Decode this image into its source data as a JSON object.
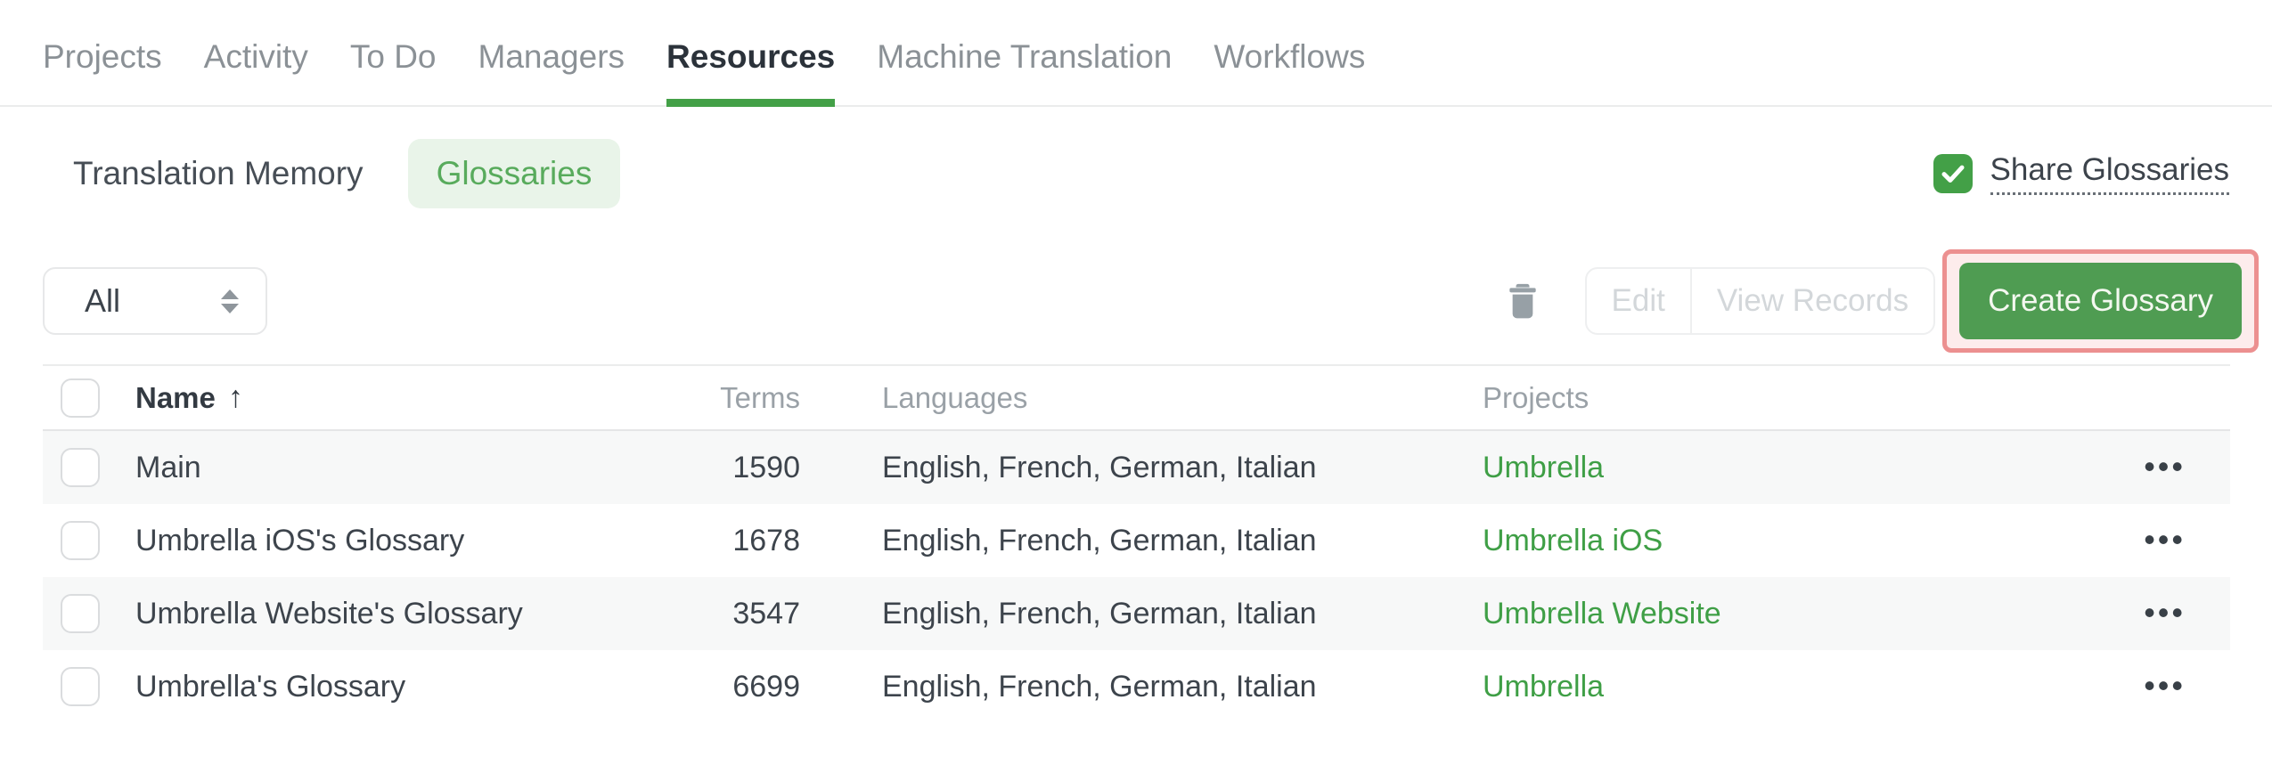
{
  "nav": {
    "tabs": [
      {
        "label": "Projects",
        "active": false
      },
      {
        "label": "Activity",
        "active": false
      },
      {
        "label": "To Do",
        "active": false
      },
      {
        "label": "Managers",
        "active": false
      },
      {
        "label": "Resources",
        "active": true
      },
      {
        "label": "Machine Translation",
        "active": false
      },
      {
        "label": "Workflows",
        "active": false
      }
    ]
  },
  "subnav": {
    "tabs": [
      {
        "label": "Translation Memory",
        "active": false
      },
      {
        "label": "Glossaries",
        "active": true
      }
    ],
    "share": {
      "label": "Share Glossaries",
      "checked": true
    }
  },
  "toolbar": {
    "filter": {
      "value": "All"
    },
    "edit_label": "Edit",
    "view_records_label": "View Records",
    "create_label": "Create Glossary"
  },
  "table": {
    "headers": {
      "name": "Name",
      "terms": "Terms",
      "languages": "Languages",
      "projects": "Projects"
    },
    "sort": {
      "column": "Name",
      "direction": "ascending",
      "glyph": "↑"
    },
    "rows": [
      {
        "name": "Main",
        "terms": "1590",
        "languages": "English, French, German, Italian",
        "project": "Umbrella"
      },
      {
        "name": "Umbrella iOS's Glossary",
        "terms": "1678",
        "languages": "English, French, German, Italian",
        "project": "Umbrella iOS"
      },
      {
        "name": "Umbrella Website's Glossary",
        "terms": "3547",
        "languages": "English, French, German, Italian",
        "project": "Umbrella Website"
      },
      {
        "name": "Umbrella's Glossary",
        "terms": "6699",
        "languages": "English, French, German, Italian",
        "project": "Umbrella"
      }
    ]
  },
  "icons": {
    "row_menu_glyph": "•••",
    "trash": "trash-icon",
    "share_check": "checkmark-icon",
    "filter_unfold": "unfold-more-icon"
  },
  "colors": {
    "accent_green": "#43a047",
    "button_green": "#4f9c52",
    "link_green": "#3f9f46",
    "active_tab_bg": "#e9f4e9",
    "active_tab_text": "#58ab5c",
    "highlight_border": "#ec9090",
    "highlight_bg": "#fdecec",
    "row_stripe": "#f7f8f8",
    "muted_text": "#8b9196",
    "disabled_text": "#d3d7da"
  }
}
